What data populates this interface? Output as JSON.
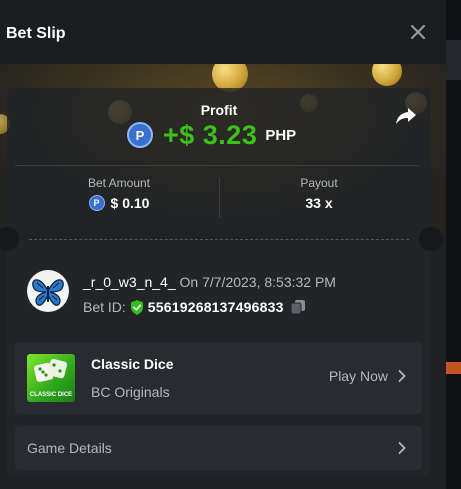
{
  "header": {
    "title": "Bet Slip"
  },
  "profit": {
    "label": "Profit",
    "currency_icon": "P",
    "amount": "+$ 3.23",
    "currency": "PHP",
    "color": "#3bc117"
  },
  "bet_amount": {
    "label": "Bet Amount",
    "currency_icon": "P",
    "value": "$ 0.10"
  },
  "payout": {
    "label": "Payout",
    "value": "33 x"
  },
  "user": {
    "name": "_r_0_w3_n_4_",
    "datetime": "On 7/7/2023, 8:53:32 PM",
    "bet_id_label": "Bet ID:",
    "bet_id": "55619268137496833"
  },
  "game": {
    "name": "Classic Dice",
    "provider": "BC Originals",
    "thumb_caption": "CLASSIC DICE",
    "play_label": "Play Now"
  },
  "details": {
    "label": "Game Details"
  },
  "icons": {
    "close": "close-icon",
    "share": "share-icon",
    "shield": "shield-check-icon",
    "copy": "copy-icon",
    "chevron": "chevron-right-icon",
    "avatar": "butterfly-avatar"
  }
}
